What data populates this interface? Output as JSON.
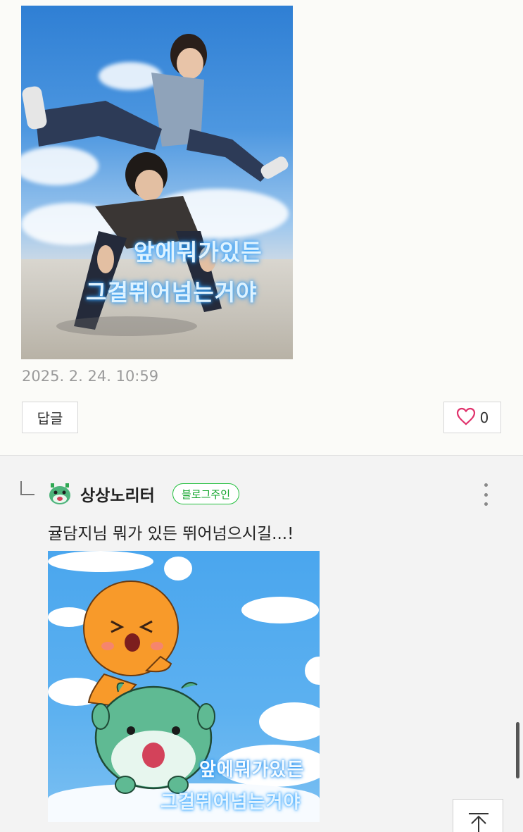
{
  "comment": {
    "image_caption_line1": "앞에뭐가있든",
    "image_caption_line2": "그걸뛰어넘는거야",
    "timestamp": "2025. 2. 24. 10:59",
    "reply_label": "답글",
    "like_count": "0"
  },
  "reply": {
    "nickname": "상상노리터",
    "badge": "블로그주인",
    "text": "귤담지님 뭐가 있든 뛰어넘으시길...!",
    "image_caption_line1": "앞에뭐가있든",
    "image_caption_line2": "그걸뛰어넘는거야"
  },
  "colors": {
    "badge_green": "#13a52c",
    "heart_pink": "#e0316b",
    "page_bg": "#fbfbf8",
    "reply_bg": "#f3f3f3"
  },
  "icons": [
    "heart-icon",
    "more-icon",
    "reply-arrow-icon",
    "scroll-top-icon"
  ]
}
